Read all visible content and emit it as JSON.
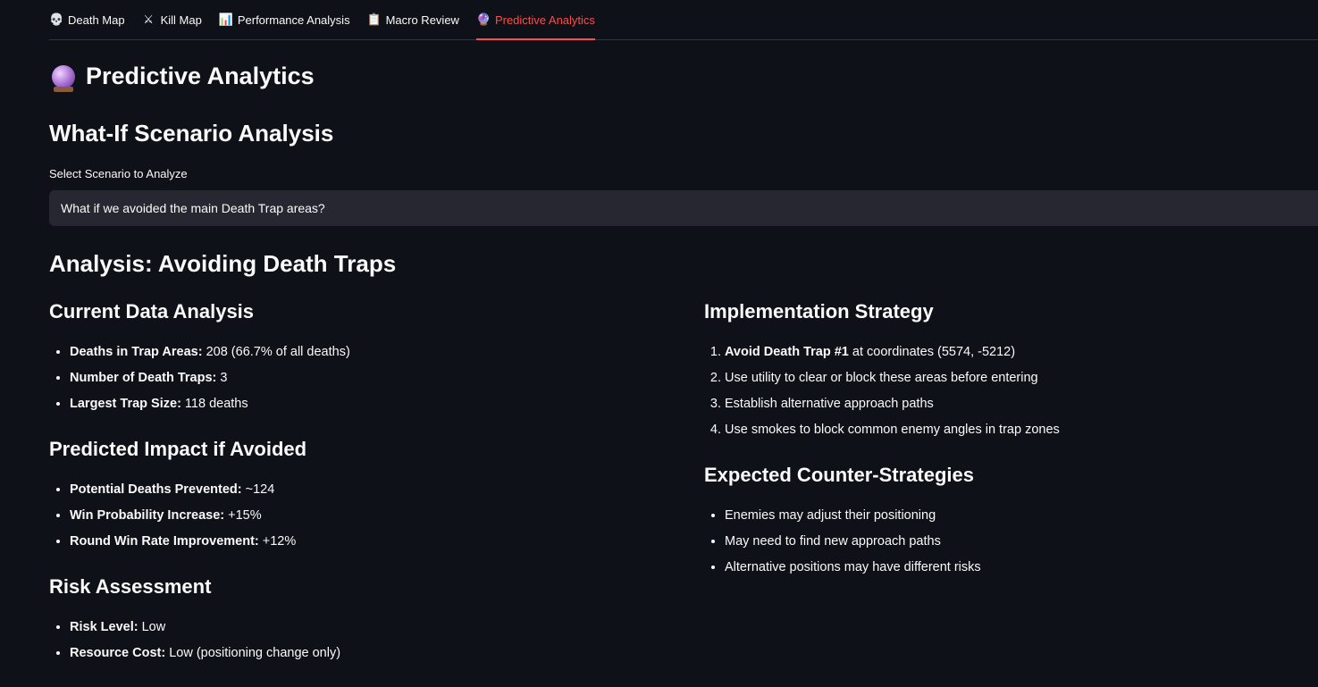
{
  "tabs": [
    {
      "icon": "💀",
      "icon_name": "skull-icon",
      "label": "Death Map"
    },
    {
      "icon": "⚔",
      "icon_name": "crossed-swords-icon",
      "label": "Kill Map"
    },
    {
      "icon": "📊",
      "icon_name": "bar-chart-icon",
      "label": "Performance Analysis"
    },
    {
      "icon": "📋",
      "icon_name": "clipboard-icon",
      "label": "Macro Review"
    },
    {
      "icon": "🔮",
      "icon_name": "crystal-ball-icon",
      "label": "Predictive Analytics"
    }
  ],
  "active_tab_index": 4,
  "accent_color": "#ff4b4b",
  "page": {
    "title": "Predictive Analytics",
    "title_icon": "crystal-ball-icon",
    "scenario_heading": "What-If Scenario Analysis",
    "select_label": "Select Scenario to Analyze",
    "select_value": "What if we avoided the main Death Trap areas?",
    "analysis_heading": "Analysis: Avoiding Death Traps"
  },
  "left": {
    "current": {
      "heading": "Current Data Analysis",
      "items": [
        {
          "bold": "Deaths in Trap Areas:",
          "text": " 208 (66.7% of all deaths)"
        },
        {
          "bold": "Number of Death Traps:",
          "text": " 3"
        },
        {
          "bold": "Largest Trap Size:",
          "text": " 118 deaths"
        }
      ]
    },
    "impact": {
      "heading": "Predicted Impact if Avoided",
      "items": [
        {
          "bold": "Potential Deaths Prevented:",
          "text": " ~124"
        },
        {
          "bold": "Win Probability Increase:",
          "text": " +15%"
        },
        {
          "bold": "Round Win Rate Improvement:",
          "text": " +12%"
        }
      ]
    },
    "risk": {
      "heading": "Risk Assessment",
      "items": [
        {
          "bold": "Risk Level:",
          "text": " Low"
        },
        {
          "bold": "Resource Cost:",
          "text": " Low (positioning change only)"
        }
      ]
    }
  },
  "right": {
    "strategy": {
      "heading": "Implementation Strategy",
      "items": [
        {
          "bold": "Avoid Death Trap #1",
          "text": " at coordinates (5574, -5212)"
        },
        {
          "bold": "",
          "text": "Use utility to clear or block these areas before entering"
        },
        {
          "bold": "",
          "text": "Establish alternative approach paths"
        },
        {
          "bold": "",
          "text": "Use smokes to block common enemy angles in trap zones"
        }
      ]
    },
    "counter": {
      "heading": "Expected Counter-Strategies",
      "items": [
        {
          "bold": "",
          "text": "Enemies may adjust their positioning"
        },
        {
          "bold": "",
          "text": "May need to find new approach paths"
        },
        {
          "bold": "",
          "text": "Alternative positions may have different risks"
        }
      ]
    }
  }
}
